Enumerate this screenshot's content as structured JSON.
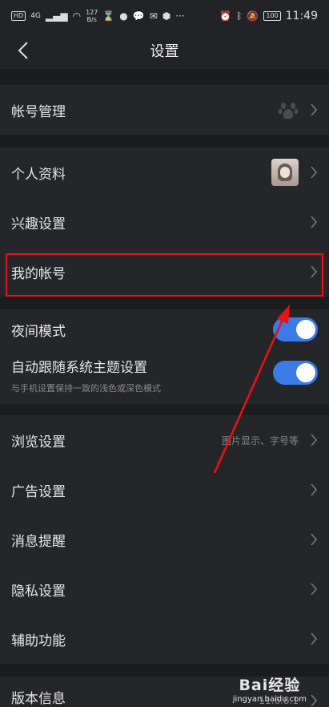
{
  "status_bar": {
    "network_badge": "HD",
    "network_type": "4G",
    "speed_value": "127",
    "speed_unit": "B/s",
    "battery": "100",
    "time": "11:49"
  },
  "header": {
    "title": "设置"
  },
  "rows": {
    "account_manage": {
      "label": "帐号管理"
    },
    "profile": {
      "label": "个人资料"
    },
    "interests": {
      "label": "兴趣设置"
    },
    "my_account": {
      "label": "我的帐号"
    },
    "night_mode": {
      "label": "夜间模式",
      "enabled": true
    },
    "follow_system": {
      "label": "自动跟随系统主题设置",
      "hint": "与手机设置保持一致的浅色或深色模式",
      "enabled": true
    },
    "browse": {
      "label": "浏览设置",
      "sub": "图片显示、字号等"
    },
    "ads": {
      "label": "广告设置"
    },
    "messages": {
      "label": "消息提醒"
    },
    "privacy": {
      "label": "隐私设置"
    },
    "accessibility": {
      "label": "辅助功能"
    },
    "version": {
      "label": "版本信息",
      "value": "11.6.8.1"
    }
  },
  "watermark": {
    "brand": "Bai经验",
    "url": "jingyan.baidu.com"
  },
  "colors": {
    "toggle_on": "#3b7be8",
    "highlight": "#e11111",
    "background": "#1b1c1e"
  }
}
